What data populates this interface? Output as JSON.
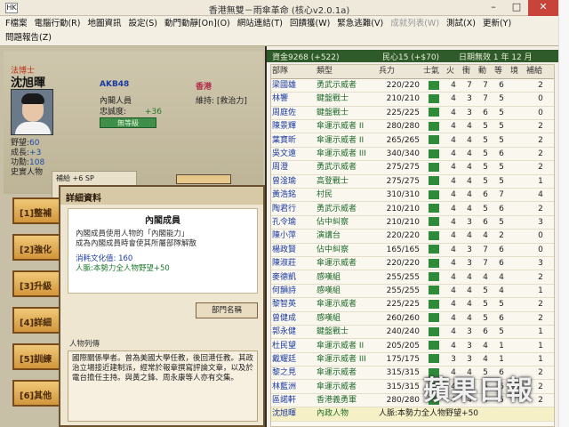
{
  "window": {
    "title": "香港無雙－雨傘革命 (核心v2.0.1a)",
    "icon_label": "HK"
  },
  "menu": {
    "row1": [
      {
        "label": "F檔案"
      },
      {
        "label": "電腦行動(R)"
      },
      {
        "label": "地圖資訊"
      },
      {
        "label": "設定(S)"
      },
      {
        "label": "動門動靜[On](O)"
      },
      {
        "label": "網站連結(T)"
      },
      {
        "label": "回饋獲(W)"
      },
      {
        "label": "緊急逃難(V)"
      },
      {
        "label": "成就列表(W)",
        "disabled": true
      },
      {
        "label": "測試(X)"
      },
      {
        "label": "更新(Y)"
      }
    ],
    "row2": [
      {
        "label": "問題報告(Z)"
      }
    ]
  },
  "character": {
    "rank": "法博士",
    "name": "沈旭暉",
    "faction": "AKB48",
    "role": "內閣人員",
    "loyalty_label": "忠誠度:",
    "loyalty_value": "+36",
    "button_label": "無等級",
    "region": "香港",
    "ability": "維持: [救治力]",
    "stats": [
      {
        "label": "野望:",
        "value": "60"
      },
      {
        "label": "成長:",
        "value": "+3"
      },
      {
        "label": "功勳:",
        "value": "108"
      },
      {
        "label": "史實人物",
        "value": ""
      }
    ],
    "sp_text": "補給 +6 SP"
  },
  "commands": [
    {
      "label": "[1]整補"
    },
    {
      "label": "[2]強化"
    },
    {
      "label": "[3]升級"
    },
    {
      "label": "[4]詳細"
    },
    {
      "label": "[5]訓練"
    },
    {
      "label": "[6]其他"
    }
  ],
  "detail": {
    "header": "詳細資料",
    "title": "內閣成員",
    "desc1": "內閣成員使用人物的「內閣能力」",
    "desc2": "成為內閣成員時會使其所屬部隊解散",
    "cost": "消耗文化值: 160",
    "effect": "人脈:本勢力全人物野望+50",
    "dept_button": "部門名稱",
    "list_label": "人物列傳",
    "bio": "國際關係學者。曾為美國大學任教，後回港任教。其政治立場接近建制派，經常於報章撰寫評論文章，以及於電台擔任主持。與黃之鋒、周永康等人亦有交集。"
  },
  "info": {
    "funds": "資金9268 (+522)",
    "morale": "民心15 (+$70)",
    "date": "日期無效 1 年 12 月"
  },
  "table": {
    "headers": [
      "部隊",
      "類型",
      "兵力",
      "士氣",
      "火",
      "衝",
      "動",
      "等",
      "境",
      "補給"
    ],
    "rows": [
      {
        "name": "梁國雄",
        "cls": "勇武示威者",
        "hp": "220/220",
        "a": "4",
        "b": "7",
        "c": "7",
        "d": "6",
        "e": "",
        "f": "2"
      },
      {
        "name": "林響",
        "cls": "鍵盤戰士",
        "hp": "210/210",
        "a": "4",
        "b": "3",
        "c": "7",
        "d": "5",
        "e": "",
        "f": "0"
      },
      {
        "name": "周庭佐",
        "cls": "鍵盤戰士",
        "hp": "225/225",
        "a": "4",
        "b": "3",
        "c": "6",
        "d": "5",
        "e": "",
        "f": "0"
      },
      {
        "name": "陳景輝",
        "cls": "傘運示威者 II",
        "hp": "280/280",
        "a": "4",
        "b": "4",
        "c": "5",
        "d": "5",
        "e": "",
        "f": "2"
      },
      {
        "name": "葉寶昕",
        "cls": "傘運示威者 II",
        "hp": "265/265",
        "a": "4",
        "b": "4",
        "c": "5",
        "d": "5",
        "e": "",
        "f": "2"
      },
      {
        "name": "吳文遠",
        "cls": "傘運示威者 III",
        "hp": "340/340",
        "a": "4",
        "b": "4",
        "c": "5",
        "d": "6",
        "e": "",
        "f": "2"
      },
      {
        "name": "周澄",
        "cls": "勇武示威者",
        "hp": "275/275",
        "a": "4",
        "b": "4",
        "c": "5",
        "d": "5",
        "e": "",
        "f": "2"
      },
      {
        "name": "曾淦瑜",
        "cls": "高登戰士",
        "hp": "275/275",
        "a": "4",
        "b": "4",
        "c": "5",
        "d": "5",
        "e": "",
        "f": "1"
      },
      {
        "name": "黃浩銘",
        "cls": "村民",
        "hp": "310/310",
        "a": "4",
        "b": "4",
        "c": "6",
        "d": "7",
        "e": "",
        "f": "4"
      },
      {
        "name": "陶君行",
        "cls": "勇武示威者",
        "hp": "210/210",
        "a": "4",
        "b": "4",
        "c": "5",
        "d": "6",
        "e": "",
        "f": "2"
      },
      {
        "name": "孔令瑜",
        "cls": "佔中糾察",
        "hp": "210/210",
        "a": "4",
        "b": "3",
        "c": "6",
        "d": "5",
        "e": "",
        "f": "3"
      },
      {
        "name": "陳小萍",
        "cls": "演講台",
        "hp": "220/220",
        "a": "4",
        "b": "4",
        "c": "4",
        "d": "2",
        "e": "",
        "f": "0"
      },
      {
        "name": "楊政賢",
        "cls": "佔中糾察",
        "hp": "165/165",
        "a": "4",
        "b": "3",
        "c": "7",
        "d": "6",
        "e": "",
        "f": "0"
      },
      {
        "name": "陳淑莊",
        "cls": "傘運示威者",
        "hp": "220/220",
        "a": "4",
        "b": "3",
        "c": "7",
        "d": "6",
        "e": "",
        "f": "3"
      },
      {
        "name": "麥德凱",
        "cls": "感嘆組",
        "hp": "255/255",
        "a": "4",
        "b": "4",
        "c": "4",
        "d": "4",
        "e": "",
        "f": "2"
      },
      {
        "name": "何韻詩",
        "cls": "感嘆組",
        "hp": "255/255",
        "a": "4",
        "b": "4",
        "c": "5",
        "d": "4",
        "e": "",
        "f": "1"
      },
      {
        "name": "黎智英",
        "cls": "傘運示威者",
        "hp": "225/225",
        "a": "4",
        "b": "4",
        "c": "5",
        "d": "5",
        "e": "",
        "f": "2"
      },
      {
        "name": "曾健成",
        "cls": "感嘆組",
        "hp": "260/260",
        "a": "4",
        "b": "4",
        "c": "5",
        "d": "6",
        "e": "",
        "f": "2"
      },
      {
        "name": "郭永健",
        "cls": "鍵盤戰士",
        "hp": "240/240",
        "a": "4",
        "b": "3",
        "c": "6",
        "d": "5",
        "e": "",
        "f": "1"
      },
      {
        "name": "杜民望",
        "cls": "傘運示威者 II",
        "hp": "205/205",
        "a": "4",
        "b": "3",
        "c": "4",
        "d": "1",
        "e": "",
        "f": "1"
      },
      {
        "name": "戴耀廷",
        "cls": "傘運示威者 III",
        "hp": "175/175",
        "a": "3",
        "b": "3",
        "c": "4",
        "d": "1",
        "e": "",
        "f": "1"
      },
      {
        "name": "黎之見",
        "cls": "傘運示威者",
        "hp": "315/315",
        "a": "4",
        "b": "4",
        "c": "5",
        "d": "6",
        "e": "",
        "f": "2"
      },
      {
        "name": "林藍洲",
        "cls": "傘運示威者",
        "hp": "315/315",
        "a": "4",
        "b": "4",
        "c": "5",
        "d": "6",
        "e": "",
        "f": "2"
      },
      {
        "name": "區諾軒",
        "cls": "香港義勇軍",
        "hp": "280/280",
        "a": "4",
        "b": "4",
        "c": "5",
        "d": "5",
        "e": "",
        "f": "2"
      }
    ],
    "selected": {
      "name": "沈旭暉",
      "cls": "內政人物",
      "effect": "人脈:本勢力全人物野望+50"
    }
  },
  "watermark": "蘋果日報",
  "colors": {
    "accent_green": "#2f5a2a",
    "faction_blue": "#1a3aa0",
    "region_pink": "#b02848",
    "command_orange": "#d2963c"
  }
}
